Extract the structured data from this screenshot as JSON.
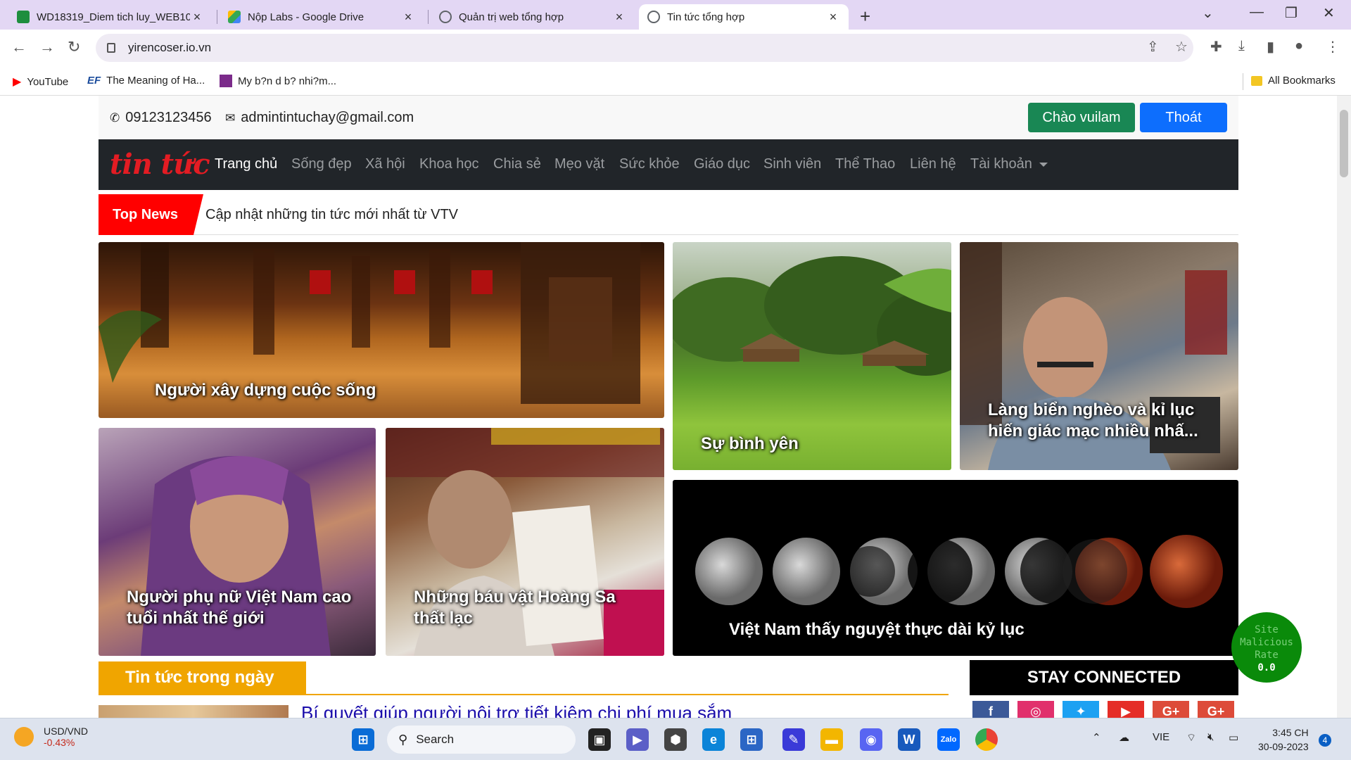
{
  "browser": {
    "tabs": [
      {
        "title": "WD18319_Diem tich luy_WEB10",
        "color": "#1e8e3e"
      },
      {
        "title": "Nộp Labs - Google Drive",
        "color": "#fbbc04"
      },
      {
        "title": "Quản trị web tổng hợp",
        "color": "#5f6368"
      },
      {
        "title": "Tin tức tổng hợp",
        "color": "#5f6368"
      }
    ],
    "url": "yirencoser.io.vn",
    "bookmarks": [
      {
        "label": "YouTube"
      },
      {
        "label": "The Meaning of Ha..."
      },
      {
        "label": "My b?n d b? nhi?m..."
      }
    ],
    "all_bookmarks": "All Bookmarks"
  },
  "topbar": {
    "phone": "09123123456",
    "email": "admintintuchay@gmail.com",
    "greeting_button": "Chào vuilam",
    "logout_button": "Thoát"
  },
  "navbar": {
    "logo": "tin tức",
    "items": [
      "Trang chủ",
      "Sống đẹp",
      "Xã hội",
      "Khoa học",
      "Chia sẻ",
      "Mẹo vặt",
      "Sức khỏe",
      "Giáo dục",
      "Sinh viên",
      "Thể Thao",
      "Liên hệ",
      "Tài khoản"
    ]
  },
  "ticker": {
    "label": "Top News",
    "text": "Cập nhật những tin tức mới nhất từ VTV"
  },
  "featured": [
    {
      "caption": "Người xây dựng cuộc sống"
    },
    {
      "caption": "Sự bình yên"
    },
    {
      "caption": "Làng biển nghèo và kỉ lục hiến giác mạc nhiều nhấ..."
    },
    {
      "caption": "Người phụ nữ Việt Nam cao tuổi nhất thế giới"
    },
    {
      "caption": "Những báu vật Hoàng Sa thất lạc"
    },
    {
      "caption": "Việt Nam thấy nguyệt thực dài kỷ lục"
    }
  ],
  "daily": {
    "title": "Tin tức trong ngày",
    "first_link": "Bí quyết giúp người nội trợ tiết kiệm chi phí mua sắm"
  },
  "sidebar": {
    "stay_connected": "STAY CONNECTED",
    "social": [
      {
        "icon": "facebook-icon",
        "glyph": "f",
        "color": "#3b5998"
      },
      {
        "icon": "instagram-icon",
        "glyph": "◎",
        "color": "#e1306c"
      },
      {
        "icon": "twitter-icon",
        "glyph": "✦",
        "color": "#1da1f2"
      },
      {
        "icon": "youtube-icon",
        "glyph": "▶",
        "color": "#e52d27"
      },
      {
        "icon": "google-plus-icon",
        "glyph": "G+",
        "color": "#dd4b39"
      },
      {
        "icon": "google-plus-icon",
        "glyph": "G+",
        "color": "#dd4b39"
      }
    ]
  },
  "malicious_widget": {
    "line1": "Site",
    "line2": "Malicious",
    "line3": "Rate",
    "value": "0.0"
  },
  "taskbar": {
    "fx_pair": "USD/VND",
    "fx_change": "-0.43%",
    "search": "Search",
    "lang": "VIE",
    "time": "3:45 CH",
    "date": "30-09-2023",
    "notifications": "4"
  }
}
